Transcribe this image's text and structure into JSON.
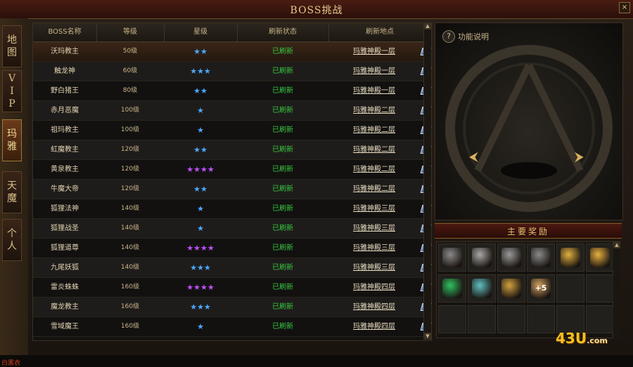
{
  "window": {
    "title": "BOSS挑战",
    "close_label": "×"
  },
  "side_tabs": [
    {
      "label": "地\n图",
      "active": false
    },
    {
      "label": "V\nI\nP",
      "active": false
    },
    {
      "label": "玛\n雅",
      "active": true
    },
    {
      "label": "天\n魔",
      "active": false
    },
    {
      "label": "个\n人",
      "active": false
    }
  ],
  "corner_text": "白黑衣",
  "table": {
    "headers": [
      "BOSS名称",
      "等级",
      "星级",
      "刷新状态",
      "刷新地点"
    ],
    "rows": [
      {
        "name": "沃玛教主",
        "level": "50级",
        "stars": "★★",
        "star_color": "#4aa8ff",
        "status": "已刷新",
        "location": "玛雅神殿一层"
      },
      {
        "name": "触龙神",
        "level": "60级",
        "stars": "★★★",
        "star_color": "#4aa8ff",
        "status": "已刷新",
        "location": "玛雅神殿一层"
      },
      {
        "name": "野白猪王",
        "level": "80级",
        "stars": "★★",
        "star_color": "#4aa8ff",
        "status": "已刷新",
        "location": "玛雅神殿一层"
      },
      {
        "name": "赤月恶魔",
        "level": "100级",
        "stars": "★",
        "star_color": "#4aa8ff",
        "status": "已刷新",
        "location": "玛雅神殿二层"
      },
      {
        "name": "祖玛教主",
        "level": "100级",
        "stars": "★",
        "star_color": "#4aa8ff",
        "status": "已刷新",
        "location": "玛雅神殿二层"
      },
      {
        "name": "虹魔教主",
        "level": "120级",
        "stars": "★★",
        "star_color": "#4aa8ff",
        "status": "已刷新",
        "location": "玛雅神殿二层"
      },
      {
        "name": "黄泉教主",
        "level": "120级",
        "stars": "★★★★",
        "star_color": "#c050ff",
        "status": "已刷新",
        "location": "玛雅神殿二层"
      },
      {
        "name": "牛魔大帝",
        "level": "120级",
        "stars": "★★",
        "star_color": "#4aa8ff",
        "status": "已刷新",
        "location": "玛雅神殿二层"
      },
      {
        "name": "狐狸法神",
        "level": "140级",
        "stars": "★",
        "star_color": "#4aa8ff",
        "status": "已刷新",
        "location": "玛雅神殿三层"
      },
      {
        "name": "狐狸战圣",
        "level": "140级",
        "stars": "★",
        "star_color": "#4aa8ff",
        "status": "已刷新",
        "location": "玛雅神殿三层"
      },
      {
        "name": "狐狸道尊",
        "level": "140级",
        "stars": "★★★★",
        "star_color": "#c050ff",
        "status": "已刷新",
        "location": "玛雅神殿三层"
      },
      {
        "name": "九尾妖狐",
        "level": "140级",
        "stars": "★★★",
        "star_color": "#4aa8ff",
        "status": "已刷新",
        "location": "玛雅神殿三层"
      },
      {
        "name": "雷炎蛛蛛",
        "level": "160级",
        "stars": "★★★★",
        "star_color": "#c050ff",
        "status": "已刷新",
        "location": "玛雅神殿四层"
      },
      {
        "name": "魔龙教主",
        "level": "160级",
        "stars": "★★★",
        "star_color": "#4aa8ff",
        "status": "已刷新",
        "location": "玛雅神殿四层"
      },
      {
        "name": "雪域魔王",
        "level": "160级",
        "stars": "★",
        "star_color": "#4aa8ff",
        "status": "已刷新",
        "location": "玛雅神殿四层"
      }
    ]
  },
  "help": {
    "icon": "?",
    "label": "功能说明"
  },
  "arrows": {
    "left": "⮜",
    "right": "⮞"
  },
  "rewards": {
    "title": "主要奖励",
    "items": [
      {
        "icon": "axe-icon",
        "color": "#8a8a8a"
      },
      {
        "icon": "sword-icon",
        "color": "#a8a8a8"
      },
      {
        "icon": "helmet-icon",
        "color": "#9a9a9a"
      },
      {
        "icon": "battle-axe-icon",
        "color": "#8a8a8a"
      },
      {
        "icon": "ticket-icon",
        "color": "#e0b040"
      },
      {
        "icon": "gold-ingot-icon",
        "color": "#e8b040"
      },
      {
        "icon": "green-gem-icon",
        "color": "#30c060"
      },
      {
        "icon": "potion-jar-icon",
        "color": "#60c0c0"
      },
      {
        "icon": "scroll-icon",
        "color": "#d0a040"
      },
      {
        "icon": "plus-five-icon",
        "color": "#d0a060",
        "label": "+5"
      }
    ]
  },
  "watermark": {
    "main": "43U",
    "suffix": ".com"
  }
}
